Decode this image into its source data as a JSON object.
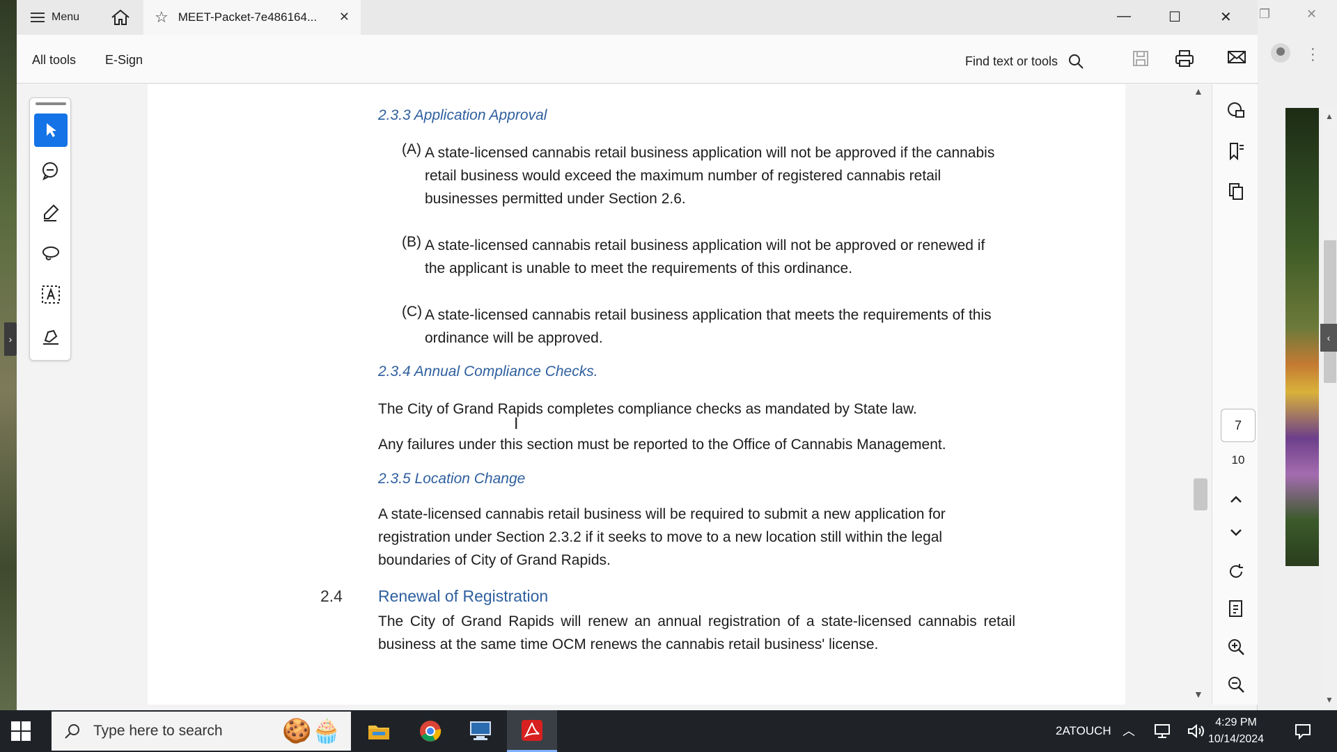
{
  "titlebar": {
    "menu_label": "Menu",
    "tab_title": "MEET-Packet-7e486164...",
    "tab_close": "✕",
    "minimize": "—",
    "maximize": "☐",
    "close": "✕"
  },
  "toolbar": {
    "all_tools": "All tools",
    "esign": "E-Sign",
    "find": "Find text or tools"
  },
  "document": {
    "h_233": "2.3.3 Application Approval",
    "a_letter": "(A)",
    "a_text": "A state-licensed cannabis retail business application will not be approved if the cannabis retail business would exceed the maximum number of registered cannabis retail businesses permitted under Section 2.6.",
    "b_letter": "(B)",
    "b_text": "A state-licensed cannabis retail business application will not be approved or renewed if the applicant is unable to meet the requirements of this ordinance.",
    "c_letter": "(C)",
    "c_text": "A state-licensed cannabis retail business application that meets the requirements of this ordinance will be approved.",
    "h_234": "2.3.4 Annual Compliance Checks.",
    "p_234_1": "The City of Grand Rapids completes compliance checks as mandated by State law.",
    "p_234_2": "Any failures under this section must be reported to the Office of Cannabis Management.",
    "h_235": "2.3.5 Location Change",
    "p_235": "A state-licensed cannabis retail business will be required to submit a new application for registration under Section 2.3.2 if it seeks to move to a new location still within the legal boundaries of City of Grand Rapids.",
    "num_24": "2.4",
    "h_24": "Renewal of Registration",
    "p_24": "The City of Grand Rapids will renew an annual registration of a state-licensed cannabis retail business at the same time OCM renews the cannabis retail business' license."
  },
  "navigation": {
    "current_page": "7",
    "total_pages": "10"
  },
  "taskbar": {
    "search_placeholder": "Type here to search",
    "tray_label": "2ATOUCH",
    "time": "4:29 PM",
    "date": "10/14/2024"
  },
  "colors": {
    "accent": "#1473e6",
    "heading": "#2e5f9e",
    "acrobat_red": "#d7201f"
  },
  "icons": {
    "tools": [
      "select-icon",
      "comment-icon",
      "highlight-icon",
      "lasso-icon",
      "text-select-icon",
      "sign-icon"
    ],
    "right_rail": [
      "comments-panel-icon",
      "bookmarks-icon",
      "pages-icon",
      "page-up-icon",
      "page-down-icon",
      "rotate-icon",
      "fit-page-icon",
      "zoom-in-icon",
      "zoom-out-icon"
    ]
  }
}
